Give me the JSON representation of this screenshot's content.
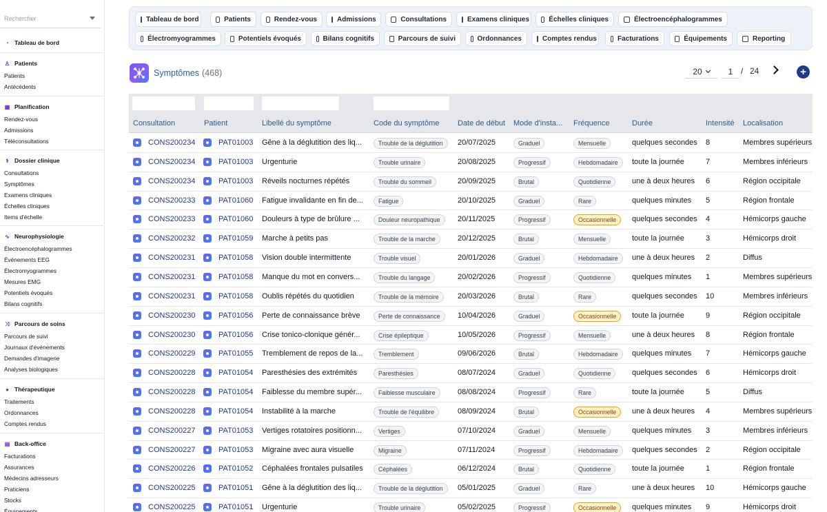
{
  "search": {
    "placeholder": "Rechercher"
  },
  "sidebar": {
    "sections": [
      {
        "title": "Tableau de bord",
        "icon": "dashboard-icon",
        "items": []
      },
      {
        "title": "Patients",
        "icon": "user-icon",
        "items": [
          "Patients",
          "Antécédents"
        ]
      },
      {
        "title": "Planification",
        "icon": "calendar-icon",
        "items": [
          "Rendez-vous",
          "Admissions",
          "Téléconsultations"
        ]
      },
      {
        "title": "Dossier clinique",
        "icon": "stethoscope-icon",
        "items": [
          "Consultations",
          "Symptômes",
          "Examens cliniques",
          "Échelles cliniques",
          "Items d'échelle"
        ]
      },
      {
        "title": "Neurophysiologie",
        "icon": "waveform-icon",
        "items": [
          "Électroencéphalogrammes",
          "Événements EEG",
          "Électromyogrammes",
          "Mesures EMG",
          "Potentiels évoqués",
          "Bilans cognitifs"
        ]
      },
      {
        "title": "Parcours de soins",
        "icon": "route-icon",
        "items": [
          "Parcours de suivi",
          "Journaux d'événements",
          "Demandes d'imagerie",
          "Analyses biologiques"
        ]
      },
      {
        "title": "Thérapeutique",
        "icon": "pills-icon",
        "items": [
          "Traitements",
          "Ordonnances",
          "Comptes rendus"
        ]
      },
      {
        "title": "Back-office",
        "icon": "building-icon",
        "items": [
          "Facturations",
          "Assurances",
          "Médecins adresseurs",
          "Praticiens",
          "Stocks",
          "Équipements"
        ]
      }
    ]
  },
  "toolbar": {
    "row1": [
      "Tableau de bord",
      "Patients",
      "Rendez-vous",
      "Admissions",
      "Consultations",
      "Examens cliniques",
      "Échelles cliniques",
      "Électroencéphalogrammes"
    ],
    "row2": [
      "Électromyogrammes",
      "Potentiels évoqués",
      "Bilans cognitifs",
      "Parcours de suivi",
      "Ordonnances",
      "Comptes rendus",
      "Facturations",
      "Équipements",
      "Reporting"
    ]
  },
  "page": {
    "title": "Symptômes",
    "count": "(468)"
  },
  "pager": {
    "page_size": "20",
    "page": "1",
    "slash": "/",
    "total_pages": "24"
  },
  "add_button": "+",
  "table": {
    "columns": [
      "Consultation",
      "Patient",
      "Libellé du symptôme",
      "Code du symptôme",
      "Date de début",
      "Mode d'insta...",
      "Fréquence",
      "Durée",
      "Intensité",
      "Localisation"
    ],
    "rows": [
      {
        "consultation": "CONS200234",
        "patient": "PAT01003",
        "label": "Gêne à la déglutition des liq...",
        "code": "Trouble de la déglutition",
        "date": "20/07/2025",
        "mode": "Graduel",
        "frequency": "Mensuelle",
        "duration": "quelques secondes",
        "intensity": "8",
        "location": "Membres supérieurs"
      },
      {
        "consultation": "CONS200234",
        "patient": "PAT01003",
        "label": "Urgenturie",
        "code": "Trouble urinaire",
        "date": "20/08/2025",
        "mode": "Progressif",
        "frequency": "Hebdomadaire",
        "duration": "toute la journée",
        "intensity": "7",
        "location": "Membres inférieurs"
      },
      {
        "consultation": "CONS200234",
        "patient": "PAT01003",
        "label": "Réveils nocturnes répétés",
        "code": "Trouble du sommeil",
        "date": "20/09/2025",
        "mode": "Brutal",
        "frequency": "Quotidienne",
        "duration": "une à deux heures",
        "intensity": "6",
        "location": "Région occipitale"
      },
      {
        "consultation": "CONS200233",
        "patient": "PAT01060",
        "label": "Fatigue invalidante en fin de...",
        "code": "Fatigue",
        "date": "20/10/2025",
        "mode": "Graduel",
        "frequency": "Rare",
        "duration": "quelques minutes",
        "intensity": "5",
        "location": "Région frontale"
      },
      {
        "consultation": "CONS200233",
        "patient": "PAT01060",
        "label": "Douleurs à type de brûlure ...",
        "code": "Douleur neuropathique",
        "date": "20/11/2025",
        "mode": "Progressif",
        "frequency": "Occasionnelle",
        "duration": "quelques secondes",
        "intensity": "4",
        "location": "Hémicorps gauche"
      },
      {
        "consultation": "CONS200232",
        "patient": "PAT01059",
        "label": "Marche à petits pas",
        "code": "Trouble de la marche",
        "date": "20/12/2025",
        "mode": "Brutal",
        "frequency": "Mensuelle",
        "duration": "toute la journée",
        "intensity": "3",
        "location": "Hémicorps droit"
      },
      {
        "consultation": "CONS200231",
        "patient": "PAT01058",
        "label": "Vision double intermittente",
        "code": "Trouble visuel",
        "date": "20/01/2026",
        "mode": "Graduel",
        "frequency": "Hebdomadaire",
        "duration": "une à deux heures",
        "intensity": "2",
        "location": "Diffus"
      },
      {
        "consultation": "CONS200231",
        "patient": "PAT01058",
        "label": "Manque du mot en convers...",
        "code": "Trouble du langage",
        "date": "20/02/2026",
        "mode": "Progressif",
        "frequency": "Quotidienne",
        "duration": "quelques minutes",
        "intensity": "1",
        "location": "Membres supérieurs"
      },
      {
        "consultation": "CONS200231",
        "patient": "PAT01058",
        "label": "Oublis répétés du quotidien",
        "code": "Trouble de la mémoire",
        "date": "20/03/2026",
        "mode": "Brutal",
        "frequency": "Rare",
        "duration": "quelques secondes",
        "intensity": "10",
        "location": "Membres inférieurs"
      },
      {
        "consultation": "CONS200230",
        "patient": "PAT01056",
        "label": "Perte de connaissance brève",
        "code": "Perte de connaissance",
        "date": "10/04/2026",
        "mode": "Graduel",
        "frequency": "Occasionnelle",
        "duration": "toute la journée",
        "intensity": "9",
        "location": "Région occipitale"
      },
      {
        "consultation": "CONS200230",
        "patient": "PAT01056",
        "label": "Crise tonico-clonique génér...",
        "code": "Crise épileptique",
        "date": "10/05/2026",
        "mode": "Progressif",
        "frequency": "Mensuelle",
        "duration": "une à deux heures",
        "intensity": "8",
        "location": "Région frontale"
      },
      {
        "consultation": "CONS200229",
        "patient": "PAT01055",
        "label": "Tremblement de repos de la...",
        "code": "Tremblement",
        "date": "09/06/2026",
        "mode": "Brutal",
        "frequency": "Hebdomadaire",
        "duration": "quelques minutes",
        "intensity": "7",
        "location": "Hémicorps gauche"
      },
      {
        "consultation": "CONS200228",
        "patient": "PAT01054",
        "label": "Paresthésies des extrémités",
        "code": "Paresthésies",
        "date": "08/07/2024",
        "mode": "Graduel",
        "frequency": "Quotidienne",
        "duration": "quelques secondes",
        "intensity": "6",
        "location": "Hémicorps droit"
      },
      {
        "consultation": "CONS200228",
        "patient": "PAT01054",
        "label": "Faiblesse du membre supér...",
        "code": "Faiblesse musculaire",
        "date": "08/08/2024",
        "mode": "Progressif",
        "frequency": "Rare",
        "duration": "toute la journée",
        "intensity": "5",
        "location": "Diffus"
      },
      {
        "consultation": "CONS200228",
        "patient": "PAT01054",
        "label": "Instabilité à la marche",
        "code": "Trouble de l'équilibre",
        "date": "08/09/2024",
        "mode": "Brutal",
        "frequency": "Occasionnelle",
        "duration": "une à deux heures",
        "intensity": "4",
        "location": "Membres supérieurs"
      },
      {
        "consultation": "CONS200227",
        "patient": "PAT01053",
        "label": "Vertiges rotatoires positionn...",
        "code": "Vertiges",
        "date": "07/10/2024",
        "mode": "Graduel",
        "frequency": "Mensuelle",
        "duration": "quelques minutes",
        "intensity": "3",
        "location": "Membres inférieurs"
      },
      {
        "consultation": "CONS200227",
        "patient": "PAT01053",
        "label": "Migraine avec aura visuelle",
        "code": "Migraine",
        "date": "07/11/2024",
        "mode": "Progressif",
        "frequency": "Hebdomadaire",
        "duration": "quelques secondes",
        "intensity": "2",
        "location": "Région occipitale"
      },
      {
        "consultation": "CONS200226",
        "patient": "PAT01052",
        "label": "Céphalées frontales pulsatiles",
        "code": "Céphalées",
        "date": "06/12/2024",
        "mode": "Brutal",
        "frequency": "Quotidienne",
        "duration": "toute la journée",
        "intensity": "1",
        "location": "Région frontale"
      },
      {
        "consultation": "CONS200225",
        "patient": "PAT01051",
        "label": "Gêne à la déglutition des liq...",
        "code": "Trouble de la déglutition",
        "date": "05/01/2025",
        "mode": "Graduel",
        "frequency": "Rare",
        "duration": "une à deux heures",
        "intensity": "10",
        "location": "Hémicorps gauche"
      },
      {
        "consultation": "CONS200225",
        "patient": "PAT01051",
        "label": "Urgenturie",
        "code": "Trouble urinaire",
        "date": "05/02/2025",
        "mode": "Progressif",
        "frequency": "Occasionnelle",
        "duration": "quelques minutes",
        "intensity": "9",
        "location": "Hémicorps droit"
      }
    ]
  },
  "colors": {
    "accent": "#1e3a8a",
    "header_text": "#2b5c8a",
    "warning_chip": "#fef3c7"
  }
}
